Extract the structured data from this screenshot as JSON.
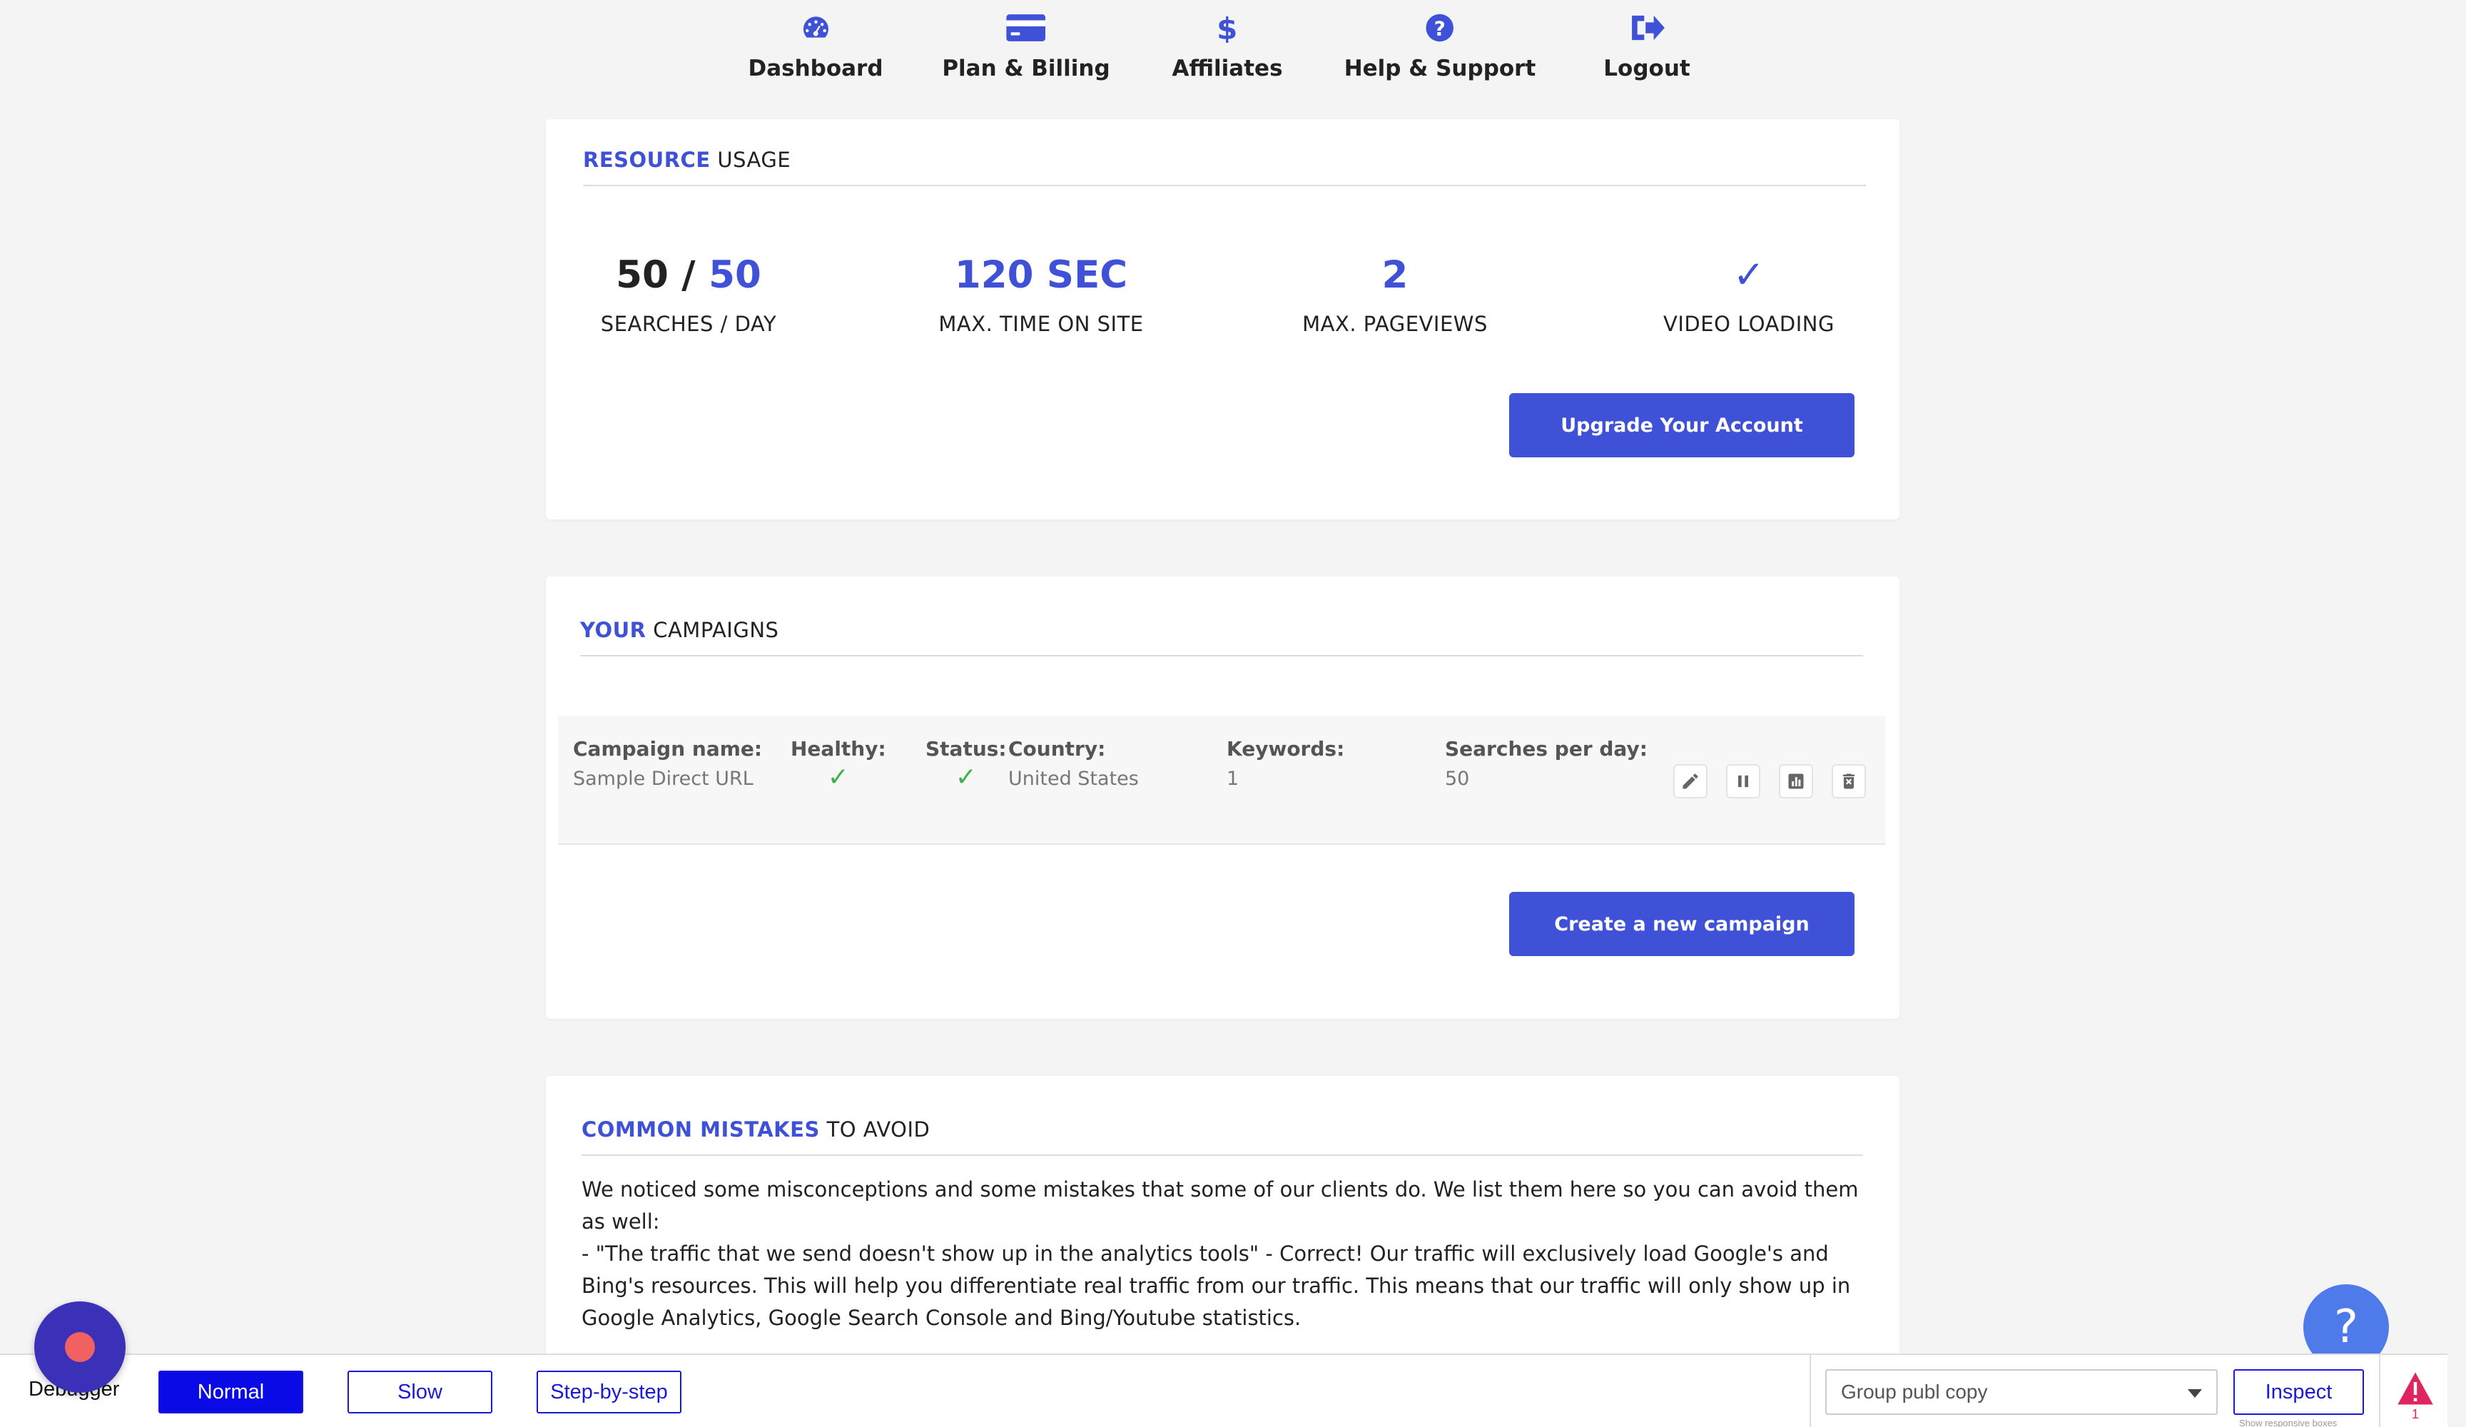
{
  "nav": {
    "items": [
      {
        "label": "Dashboard",
        "icon": "dashboard-icon"
      },
      {
        "label": "Plan & Billing",
        "icon": "credit-card-icon"
      },
      {
        "label": "Affiliates",
        "icon": "dollar-icon"
      },
      {
        "label": "Help & Support",
        "icon": "question-circle-icon"
      },
      {
        "label": "Logout",
        "icon": "logout-icon"
      }
    ]
  },
  "resource_usage": {
    "title_accent": "RESOURCE",
    "title_rest": " USAGE",
    "searches": {
      "used": "50",
      "separator": " / ",
      "total": "50",
      "label": "SEARCHES / DAY"
    },
    "time_on_site": {
      "value": "120 SEC",
      "label": "MAX. TIME ON SITE"
    },
    "pageviews": {
      "value": "2",
      "label": "MAX. PAGEVIEWS"
    },
    "video_loading": {
      "value": "✓",
      "label": "VIDEO LOADING"
    },
    "upgrade_button": "Upgrade Your Account"
  },
  "campaigns": {
    "title_accent": "YOUR",
    "title_rest": " CAMPAIGNS",
    "headers": {
      "name": "Campaign name:",
      "healthy": "Healthy:",
      "status": "Status:",
      "country": "Country:",
      "keywords": "Keywords:",
      "searches": "Searches per day:"
    },
    "rows": [
      {
        "name": "Sample Direct URL",
        "healthy": "✓",
        "status": "✓",
        "country": "United States",
        "keywords": "1",
        "searches": "50"
      }
    ],
    "actions": [
      "edit-icon",
      "pause-icon",
      "chart-icon",
      "delete-icon"
    ],
    "create_button": "Create a new campaign"
  },
  "mistakes": {
    "title_accent": "COMMON MISTAKES",
    "title_rest": " TO AVOID",
    "intro": "We noticed some misconceptions and some mistakes that some of our clients do. We list them here so you can avoid them as well:",
    "item1": "- \"The traffic that we send doesn't show up in the analytics tools\" - Correct! Our traffic will exclusively load Google's and Bing's resources. This will help you differentiate real traffic from our traffic. This means that our traffic will only show up in Google Analytics, Google Search Console and Bing/Youtube statistics."
  },
  "help_fab": "?",
  "debugger": {
    "label": "Debugger",
    "modes": [
      "Normal",
      "Slow",
      "Step-by-step"
    ],
    "active_mode": "Normal",
    "select_value": "Group publ copy",
    "inspect_label": "Inspect",
    "inspect_sub": "Show responsive boxes",
    "warning_count": "1"
  },
  "colors": {
    "accent": "#3f51d6",
    "check": "#3cb34a",
    "debug_blue": "#1a1ad6",
    "warning": "#e0245e"
  }
}
